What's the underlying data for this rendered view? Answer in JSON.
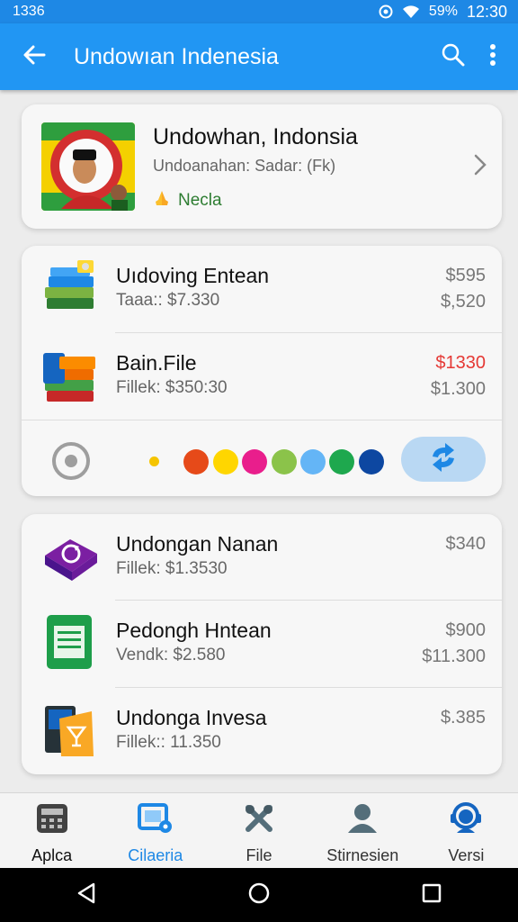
{
  "status_bar": {
    "left_text": "1336",
    "battery": "59%",
    "time": "12:30"
  },
  "app_bar": {
    "title": "Undowıan Indenesia",
    "icons": [
      "back-arrow-icon",
      "search-icon",
      "more-vert-icon"
    ]
  },
  "profile": {
    "name": "Undowhan, Indonsia",
    "subtitle": "Undoanahan: Sadar: (Fk)",
    "tag": "Necla",
    "colors": {
      "tag": "#2e7d32"
    }
  },
  "list1": [
    {
      "title": "Uıdoving Entean",
      "subtitle": "Taaa:: $7.330",
      "value1": "$595",
      "value2": "$,520",
      "icon": "books-stack-icon"
    },
    {
      "title": "Bain.File",
      "subtitle": "Fillek: $350:30",
      "value1": "$1330",
      "value2": "$1.300",
      "icon": "file-books-icon",
      "value1_color": "#e53935"
    }
  ],
  "color_dots": [
    "#f5c400",
    "#e64a19",
    "#ffd600",
    "#e91e8c",
    "#8bc34a",
    "#64b5f6",
    "#1ea84e",
    "#0d47a1"
  ],
  "list2": [
    {
      "title": "Undongan Nanan",
      "subtitle": "Fillek: $1.3530",
      "value1": "$340",
      "value2": "",
      "icon": "purple-book-icon"
    },
    {
      "title": "Pedongh Hntean",
      "subtitle": "Vendk: $2.580",
      "value1": "$900",
      "value2": "$11.300",
      "icon": "green-document-icon"
    },
    {
      "title": "Undonga Invesa",
      "subtitle": "Fillek:: 11.350",
      "value1": "$.385",
      "value2": "",
      "icon": "folder-cocktail-icon"
    }
  ],
  "bottom_nav": [
    {
      "label": "Aplca",
      "icon": "calculator-icon",
      "active": false
    },
    {
      "label": "Cilaeria",
      "icon": "tablet-gear-icon",
      "active": true
    },
    {
      "label": "File",
      "icon": "tools-icon",
      "active": false
    },
    {
      "label": "Stirnesien",
      "icon": "person-icon",
      "active": false
    },
    {
      "label": "Versi",
      "icon": "support-agent-icon",
      "active": false
    }
  ],
  "accent_color": "#2196f3"
}
